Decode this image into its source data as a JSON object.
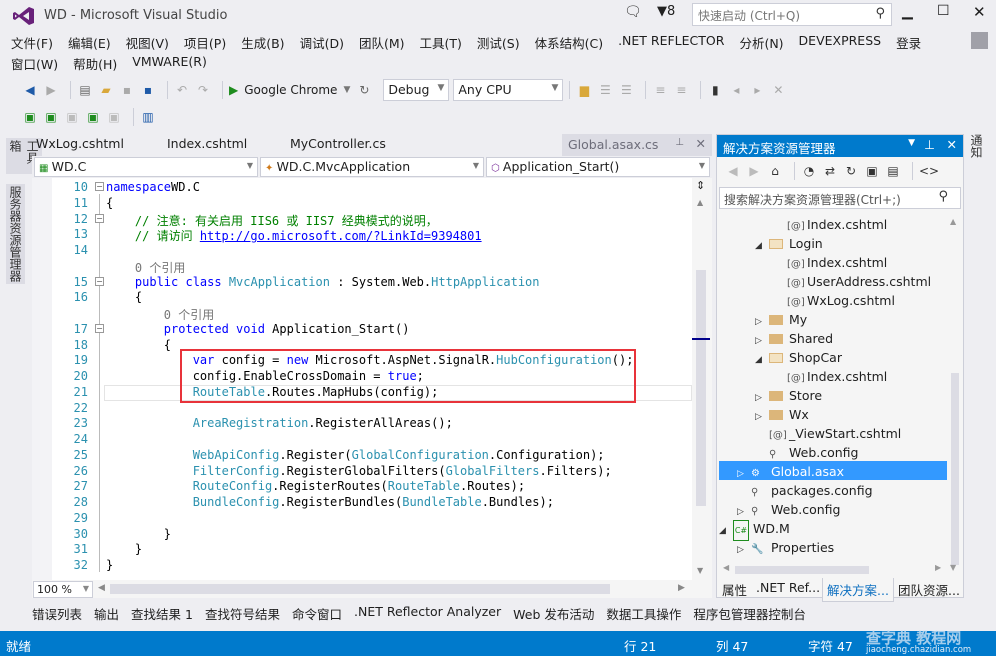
{
  "window": {
    "title": "WD - Microsoft Visual Studio",
    "notification_count": "8",
    "quick_launch_placeholder": "快速启动 (Ctrl+Q)",
    "controls": {
      "minimize": "▁",
      "maximize": "☐",
      "close": "✕"
    }
  },
  "menu": {
    "row1": [
      "文件(F)",
      "编辑(E)",
      "视图(V)",
      "项目(P)",
      "生成(B)",
      "调试(D)",
      "团队(M)",
      "工具(T)",
      "测试(S)",
      "体系结构(C)",
      ".NET REFLECTOR",
      "分析(N)",
      "DEVEXPRESS",
      "登录"
    ],
    "row2": [
      "窗口(W)",
      "帮助(H)",
      "VMWARE(R)"
    ]
  },
  "toolbar": {
    "run_target": "Google Chrome",
    "configuration": "Debug",
    "platform": "Any CPU"
  },
  "side_tabs": {
    "left": [
      "工具箱",
      "服务器资源管理器"
    ],
    "right": [
      "通知"
    ]
  },
  "editor": {
    "tabs": [
      "WxLog.cshtml",
      "Index.cshtml",
      "MyController.cs",
      "Global.asax.cs"
    ],
    "active_tab": "Global.asax.cs",
    "nav_project": "WD.C",
    "nav_class": "WD.C.MvcApplication",
    "nav_member": "Application_Start()",
    "zoom": "100 %",
    "lines": [
      {
        "n": "10",
        "code": [
          [
            "kw",
            "namespace"
          ],
          [
            "",
            "WD.C"
          ]
        ]
      },
      {
        "n": "11",
        "code": [
          [
            "",
            "{"
          ]
        ]
      },
      {
        "n": "12",
        "code": [
          [
            "cm",
            "    // 注意: 有关启用 IIS6 或 IIS7 经典模式的说明，"
          ]
        ]
      },
      {
        "n": "13",
        "code": [
          [
            "cm",
            "    // 请访问 "
          ],
          [
            "lk",
            "http://go.microsoft.com/?LinkId=9394801"
          ]
        ]
      },
      {
        "n": "14",
        "code": []
      },
      {
        "n": "",
        "code": [
          [
            "ref",
            "    0 个引用"
          ]
        ]
      },
      {
        "n": "15",
        "code": [
          [
            "kw",
            "    public class "
          ],
          [
            "ty",
            "MvcApplication"
          ],
          [
            "",
            " : System.Web."
          ],
          [
            "ty",
            "HttpApplication"
          ]
        ]
      },
      {
        "n": "16",
        "code": [
          [
            "",
            "    {"
          ]
        ]
      },
      {
        "n": "",
        "code": [
          [
            "ref",
            "        0 个引用"
          ]
        ]
      },
      {
        "n": "17",
        "code": [
          [
            "kw",
            "        protected void "
          ],
          [
            "",
            "Application_Start()"
          ]
        ]
      },
      {
        "n": "18",
        "code": [
          [
            "",
            "        {"
          ]
        ]
      },
      {
        "n": "19",
        "code": [
          [
            "kw",
            "            var "
          ],
          [
            "",
            "config = "
          ],
          [
            "kw",
            "new "
          ],
          [
            "",
            "Microsoft.AspNet.SignalR."
          ],
          [
            "ty",
            "HubConfiguration"
          ],
          [
            "",
            "();"
          ]
        ]
      },
      {
        "n": "20",
        "code": [
          [
            "",
            "            config.EnableCrossDomain = "
          ],
          [
            "kw",
            "true"
          ],
          [
            "",
            ";"
          ]
        ]
      },
      {
        "n": "21",
        "code": [
          [
            "ty",
            "            RouteTable"
          ],
          [
            "",
            ".Routes.MapHubs(config);"
          ]
        ]
      },
      {
        "n": "22",
        "code": []
      },
      {
        "n": "23",
        "code": [
          [
            "ty",
            "            AreaRegistration"
          ],
          [
            "",
            ".RegisterAllAreas();"
          ]
        ]
      },
      {
        "n": "24",
        "code": []
      },
      {
        "n": "25",
        "code": [
          [
            "ty",
            "            WebApiConfig"
          ],
          [
            "",
            ".Register("
          ],
          [
            "ty",
            "GlobalConfiguration"
          ],
          [
            "",
            ".Configuration);"
          ]
        ]
      },
      {
        "n": "26",
        "code": [
          [
            "ty",
            "            FilterConfig"
          ],
          [
            "",
            ".RegisterGlobalFilters("
          ],
          [
            "ty",
            "GlobalFilters"
          ],
          [
            "",
            ".Filters);"
          ]
        ]
      },
      {
        "n": "27",
        "code": [
          [
            "ty",
            "            RouteConfig"
          ],
          [
            "",
            ".RegisterRoutes("
          ],
          [
            "ty",
            "RouteTable"
          ],
          [
            "",
            ".Routes);"
          ]
        ]
      },
      {
        "n": "28",
        "code": [
          [
            "ty",
            "            BundleConfig"
          ],
          [
            "",
            ".RegisterBundles("
          ],
          [
            "ty",
            "BundleTable"
          ],
          [
            "",
            ".Bundles);"
          ]
        ]
      },
      {
        "n": "29",
        "code": []
      },
      {
        "n": "30",
        "code": [
          [
            "",
            "        }"
          ]
        ]
      },
      {
        "n": "31",
        "code": [
          [
            "",
            "    }"
          ]
        ]
      },
      {
        "n": "32",
        "code": [
          [
            "",
            "}"
          ]
        ]
      }
    ]
  },
  "solution_explorer": {
    "title": "解决方案资源管理器",
    "search_placeholder": "搜索解决方案资源管理器(Ctrl+;)",
    "items": [
      {
        "label": "Index.cshtml",
        "indent": 4,
        "type": "cshtml",
        "exp": ""
      },
      {
        "label": "Login",
        "indent": 3,
        "type": "folder-open",
        "exp": "◢"
      },
      {
        "label": "Index.cshtml",
        "indent": 4,
        "type": "cshtml",
        "exp": ""
      },
      {
        "label": "UserAddress.cshtml",
        "indent": 4,
        "type": "cshtml",
        "exp": ""
      },
      {
        "label": "WxLog.cshtml",
        "indent": 4,
        "type": "cshtml",
        "exp": ""
      },
      {
        "label": "My",
        "indent": 3,
        "type": "folder",
        "exp": "▷"
      },
      {
        "label": "Shared",
        "indent": 3,
        "type": "folder",
        "exp": "▷"
      },
      {
        "label": "ShopCar",
        "indent": 3,
        "type": "folder-open",
        "exp": "◢"
      },
      {
        "label": "Index.cshtml",
        "indent": 4,
        "type": "cshtml",
        "exp": ""
      },
      {
        "label": "Store",
        "indent": 3,
        "type": "folder",
        "exp": "▷"
      },
      {
        "label": "Wx",
        "indent": 3,
        "type": "folder",
        "exp": "▷"
      },
      {
        "label": "_ViewStart.cshtml",
        "indent": 3,
        "type": "cshtml",
        "exp": ""
      },
      {
        "label": "Web.config",
        "indent": 3,
        "type": "config",
        "exp": ""
      },
      {
        "label": "Global.asax",
        "indent": 2,
        "type": "asax",
        "exp": "▷",
        "selected": true
      },
      {
        "label": "packages.config",
        "indent": 2,
        "type": "config",
        "exp": ""
      },
      {
        "label": "Web.config",
        "indent": 2,
        "type": "config",
        "exp": "▷"
      },
      {
        "label": "WD.M",
        "indent": 1,
        "type": "csproj",
        "exp": "◢"
      },
      {
        "label": "Properties",
        "indent": 2,
        "type": "wrench",
        "exp": "▷"
      }
    ],
    "bottom_tabs": [
      "属性",
      ".NET Ref...",
      "解决方案...",
      "团队资源..."
    ],
    "active_bottom_tab": "解决方案..."
  },
  "tool_tabs": [
    "错误列表",
    "输出",
    "查找结果 1",
    "查找符号结果",
    "命令窗口",
    ".NET Reflector Analyzer",
    "Web 发布活动",
    "数据工具操作",
    "程序包管理器控制台"
  ],
  "status": {
    "state": "就绪",
    "line": "行 21",
    "col": "列 47",
    "char": "字符 47"
  },
  "watermark": {
    "top": "查字典 教程网",
    "bottom": "jiaocheng.chazidian.com"
  }
}
